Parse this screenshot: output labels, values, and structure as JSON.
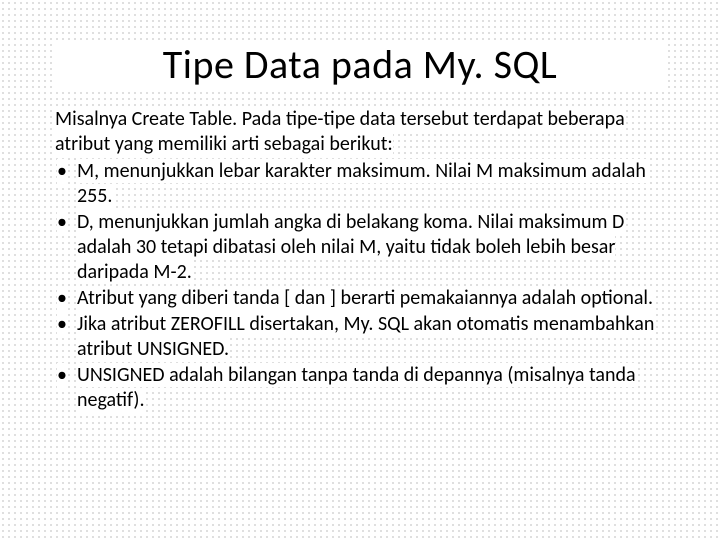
{
  "title": "Tipe Data pada My. SQL",
  "lead": "Misalnya Create Table. Pada tipe-tipe data tersebut terdapat beberapa atribut yang memiliki arti sebagai berikut:",
  "bullets": [
    "M, menunjukkan lebar karakter maksimum. Nilai M maksimum adalah 255.",
    "D, menunjukkan jumlah angka di belakang koma. Nilai maksimum D adalah 30 tetapi dibatasi oleh nilai M, yaitu tidak boleh lebih besar daripada M-2.",
    "Atribut yang diberi tanda [ dan ] berarti pemakaiannya adalah optional.",
    "Jika atribut ZEROFILL disertakan, My. SQL akan otomatis menambahkan atribut UNSIGNED.",
    "UNSIGNED adalah bilangan tanpa tanda di depannya (misalnya tanda negatif)."
  ],
  "bullet_char": "•"
}
